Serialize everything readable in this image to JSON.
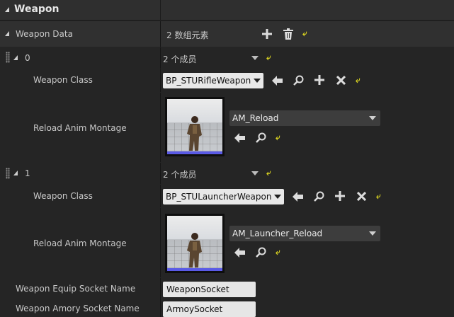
{
  "header": {
    "title": "Weapon"
  },
  "weapon_data": {
    "label": "Weapon Data",
    "summary": "2 数组元素",
    "elements": [
      {
        "index": "0",
        "members": "2 个成员",
        "weapon_class_label": "Weapon Class",
        "weapon_class_value": "BP_STURifleWeapon",
        "montage_label": "Reload Anim Montage",
        "montage_value": "AM_Reload"
      },
      {
        "index": "1",
        "members": "2 个成员",
        "weapon_class_label": "Weapon Class",
        "weapon_class_value": "BP_STULauncherWeapon",
        "montage_label": "Reload Anim Montage",
        "montage_value": "AM_Launcher_Reload"
      }
    ]
  },
  "equip_socket": {
    "label": "Weapon Equip Socket Name",
    "value": "WeaponSocket"
  },
  "armory_socket": {
    "label": "Weapon Amory Socket Name",
    "value": "ArmoySocket"
  },
  "colors": {
    "reset_arrow": "#d6d021",
    "panel_bg": "#252525",
    "header_bg": "#2e2e2e",
    "thumb_bar": "#5a5ae6"
  },
  "icons": [
    "collapse-triangle-icon",
    "add-icon",
    "delete-icon",
    "reset-to-default-icon",
    "drag-handle-icon",
    "chevron-down-icon",
    "use-selected-arrow-icon",
    "browse-magnifier-icon",
    "clear-icon"
  ]
}
